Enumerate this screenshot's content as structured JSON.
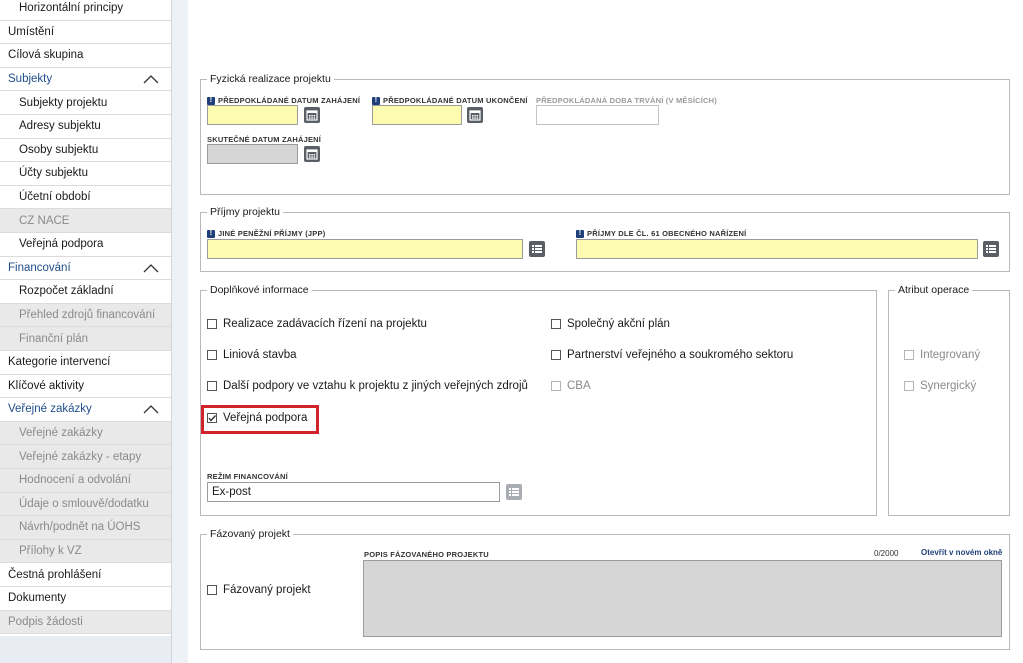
{
  "sidebar": {
    "items": [
      {
        "label": "Horizontální principy",
        "level": "sub",
        "state": "normal"
      },
      {
        "label": "Umístění",
        "level": "top",
        "state": "normal"
      },
      {
        "label": "Cílová skupina",
        "level": "top",
        "state": "normal"
      },
      {
        "label": "Subjekty",
        "level": "section",
        "state": "expanded"
      },
      {
        "label": "Subjekty projektu",
        "level": "sub",
        "state": "normal"
      },
      {
        "label": "Adresy subjektu",
        "level": "sub",
        "state": "normal"
      },
      {
        "label": "Osoby subjektu",
        "level": "sub",
        "state": "normal"
      },
      {
        "label": "Účty subjektu",
        "level": "sub",
        "state": "normal"
      },
      {
        "label": "Účetní období",
        "level": "sub",
        "state": "normal"
      },
      {
        "label": "CZ NACE",
        "level": "sub",
        "state": "disabled"
      },
      {
        "label": "Veřejná podpora",
        "level": "sub",
        "state": "normal"
      },
      {
        "label": "Financování",
        "level": "section",
        "state": "expanded"
      },
      {
        "label": "Rozpočet základní",
        "level": "sub",
        "state": "normal"
      },
      {
        "label": "Přehled zdrojů financování",
        "level": "sub",
        "state": "disabled"
      },
      {
        "label": "Finanční plán",
        "level": "sub",
        "state": "disabled"
      },
      {
        "label": "Kategorie intervencí",
        "level": "top",
        "state": "normal"
      },
      {
        "label": "Klíčové aktivity",
        "level": "top",
        "state": "normal"
      },
      {
        "label": "Veřejné zakázky",
        "level": "section",
        "state": "expanded"
      },
      {
        "label": "Veřejné zakázky",
        "level": "sub",
        "state": "disabled"
      },
      {
        "label": "Veřejné zakázky - etapy",
        "level": "sub",
        "state": "disabled"
      },
      {
        "label": "Hodnocení a odvolání",
        "level": "sub",
        "state": "disabled"
      },
      {
        "label": "Údaje o smlouvě/dodatku",
        "level": "sub",
        "state": "disabled"
      },
      {
        "label": "Návrh/podnět na ÚOHS",
        "level": "sub",
        "state": "disabled"
      },
      {
        "label": "Přílohy k VZ",
        "level": "sub",
        "state": "disabled"
      },
      {
        "label": "Čestná prohlášení",
        "level": "top",
        "state": "normal"
      },
      {
        "label": "Dokumenty",
        "level": "top",
        "state": "normal"
      },
      {
        "label": "Podpis žádosti",
        "level": "top",
        "state": "disabled"
      }
    ]
  },
  "fyzicka_realizace": {
    "legend": "Fyzická realizace projektu",
    "planned_start": {
      "label": "PŘEDPOKLÁDANÉ DATUM ZAHÁJENÍ",
      "value": "",
      "required": true
    },
    "planned_end": {
      "label": "PŘEDPOKLÁDANÉ DATUM UKONČENÍ",
      "value": "",
      "required": true
    },
    "planned_duration": {
      "label": "PŘEDPOKLÁDANÁ DOBA TRVÁNÍ (V MĚSÍCÍCH)",
      "value": ""
    },
    "actual_start": {
      "label": "SKUTEČNÉ DATUM ZAHÁJENÍ",
      "value": ""
    }
  },
  "prijmy": {
    "legend": "Příjmy projektu",
    "jpp": {
      "label": "JINÉ PENĚŽNÍ PŘÍJMY (JPP)",
      "value": "",
      "required": true
    },
    "cl61": {
      "label": "PŘÍJMY DLE ČL. 61 OBECNÉHO NAŘÍZENÍ",
      "value": "",
      "required": true
    }
  },
  "doplnkove": {
    "legend": "Doplňkové informace",
    "checkboxes": [
      {
        "label": "Realizace zadávacích řízení na projektu",
        "checked": false,
        "disabled": false
      },
      {
        "label": "Liniová stavba",
        "checked": false,
        "disabled": false
      },
      {
        "label": "Další podpory ve vztahu k projektu z jiných veřejných zdrojů",
        "checked": false,
        "disabled": false
      },
      {
        "label": "Veřejná podpora",
        "checked": true,
        "disabled": false
      },
      {
        "label": "Společný akční plán",
        "checked": false,
        "disabled": false
      },
      {
        "label": "Partnerství veřejného a soukromého sektoru",
        "checked": false,
        "disabled": false
      },
      {
        "label": "CBA",
        "checked": false,
        "disabled": true
      }
    ],
    "rezim": {
      "label": "REŽIM FINANCOVÁNÍ",
      "value": "Ex-post"
    }
  },
  "atribut": {
    "legend": "Atribut operace",
    "checkboxes": [
      {
        "label": "Integrovaný",
        "checked": false,
        "disabled": true
      },
      {
        "label": "Synergický",
        "checked": false,
        "disabled": true
      }
    ]
  },
  "fazovany": {
    "legend": "Fázovaný projekt",
    "checkbox_label": "Fázovaný projekt",
    "checked": false,
    "popis_label": "POPIS FÁZOVANÉHO PROJEKTU",
    "counter": "0/2000",
    "open_link": "Otevřít v novém okně",
    "popis_value": ""
  },
  "colors": {
    "required_fill": "#fdfbb0",
    "readonly_fill": "#d6d6d6",
    "section_link": "#1f4e8c",
    "highlight": "#d3232a"
  }
}
